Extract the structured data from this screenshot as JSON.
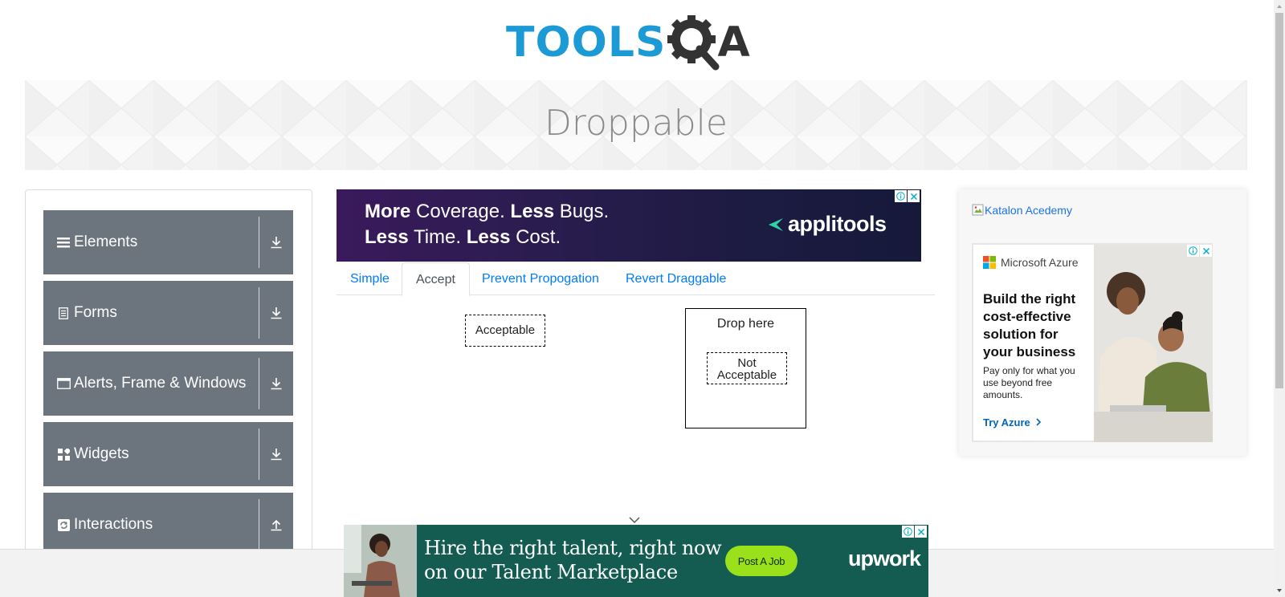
{
  "logo": {
    "part1": "TOOLS",
    "part2": "A",
    "alt": "ToolsQA"
  },
  "page": {
    "title": "Droppable"
  },
  "sidebar": {
    "groups": [
      {
        "label": "Elements",
        "icon": "list-icon",
        "expanded": false
      },
      {
        "label": "Forms",
        "icon": "document-icon",
        "expanded": false
      },
      {
        "label": "Alerts, Frame & Windows",
        "icon": "window-icon",
        "expanded": false
      },
      {
        "label": "Widgets",
        "icon": "widgets-icon",
        "expanded": false
      },
      {
        "label": "Interactions",
        "icon": "refresh-icon",
        "expanded": true
      }
    ]
  },
  "ad_top": {
    "line1_b1": "More",
    "line1_t1": " Coverage. ",
    "line1_b2": "Less",
    "line1_t2": " Bugs.",
    "line2_b1": "Less",
    "line2_t1": " Time. ",
    "line2_b2": "Less",
    "line2_t2": " Cost.",
    "brand": "applitools"
  },
  "tabs": [
    {
      "label": "Simple",
      "active": false
    },
    {
      "label": "Accept",
      "active": true
    },
    {
      "label": "Prevent Propogation",
      "active": false
    },
    {
      "label": "Revert Draggable",
      "active": false
    }
  ],
  "accept": {
    "draggable_acceptable": "Acceptable",
    "draggable_not_acceptable": "Not Acceptable",
    "drop_target": "Drop here"
  },
  "ad_right": {
    "broken_image_alt": "Katalon Acedemy",
    "brand": "Microsoft Azure",
    "headline": "Build the right cost-effective solution for your business",
    "subtext": "Pay only for what you use beyond free amounts.",
    "cta": "Try Azure"
  },
  "ad_bottom": {
    "line1": "Hire the right talent, right now",
    "line2": "on our Talent Marketplace",
    "button": "Post A Job",
    "brand": "upwork"
  },
  "colors": {
    "accent": "#007bff",
    "sidebar_group": "#6c757d",
    "logo_blue": "#1b9ad6",
    "upwork_green": "#9ae01b",
    "upwork_bg": "#145c52"
  }
}
